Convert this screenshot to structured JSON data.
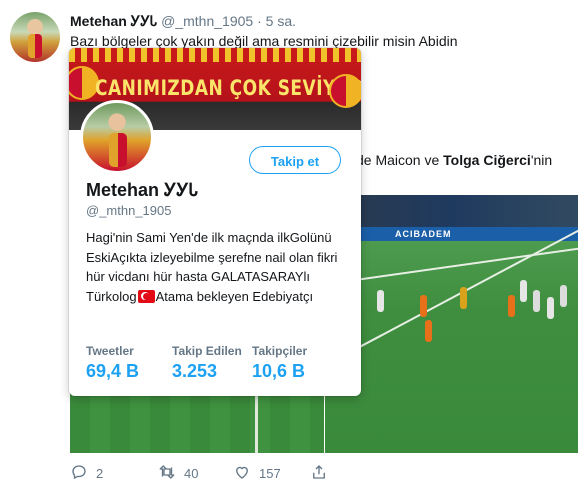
{
  "tweet": {
    "name": "Metehan ᎩᎩᏓ",
    "handle": "@_mthn_1905",
    "dot": "·",
    "time": "5 sa.",
    "text_line1": "Bazı bölgeler çok yakın değil ama resmini çizebilir misin Abidin",
    "text_line2_prefix": "de Maicon ve ",
    "text_line2_bold": "Tolga Ciğerci",
    "text_line2_suffix": "'nin",
    "photo_board_text": "ACIBADEM",
    "actions": {
      "reply_count": "2",
      "retweet_count": "40",
      "like_count": "157"
    }
  },
  "hovercard": {
    "banner_text": "CANIMIZDAN ÇOK SEVİYORUZ",
    "follow_label": "Takip et",
    "name": "Metehan ᎩᎩᏓ",
    "handle": "@_mthn_1905",
    "bio_part1": "Hagi'nin Sami Yen'de ilk maçnda ilkGolünü EskiAçıkta izleyebilme şerefne nail olan fikri hür vicdanı hür hasta GALATASARAYlı Türkolog",
    "bio_part2": "Atama bekleyen Edebiyatçı",
    "stats": [
      {
        "label": "Tweetler",
        "value": "69,4 B"
      },
      {
        "label": "Takip Edilen",
        "value": "3.253"
      },
      {
        "label": "Takipçiler",
        "value": "10,6 B"
      }
    ]
  },
  "colors": {
    "accent": "#1da1f2",
    "muted": "#657786",
    "text": "#14171a",
    "banner_red": "#c81a1a",
    "banner_yellow": "#fbe46a"
  },
  "icons": [
    "reply-icon",
    "retweet-icon",
    "like-icon",
    "share-icon",
    "turkish-flag-icon"
  ]
}
